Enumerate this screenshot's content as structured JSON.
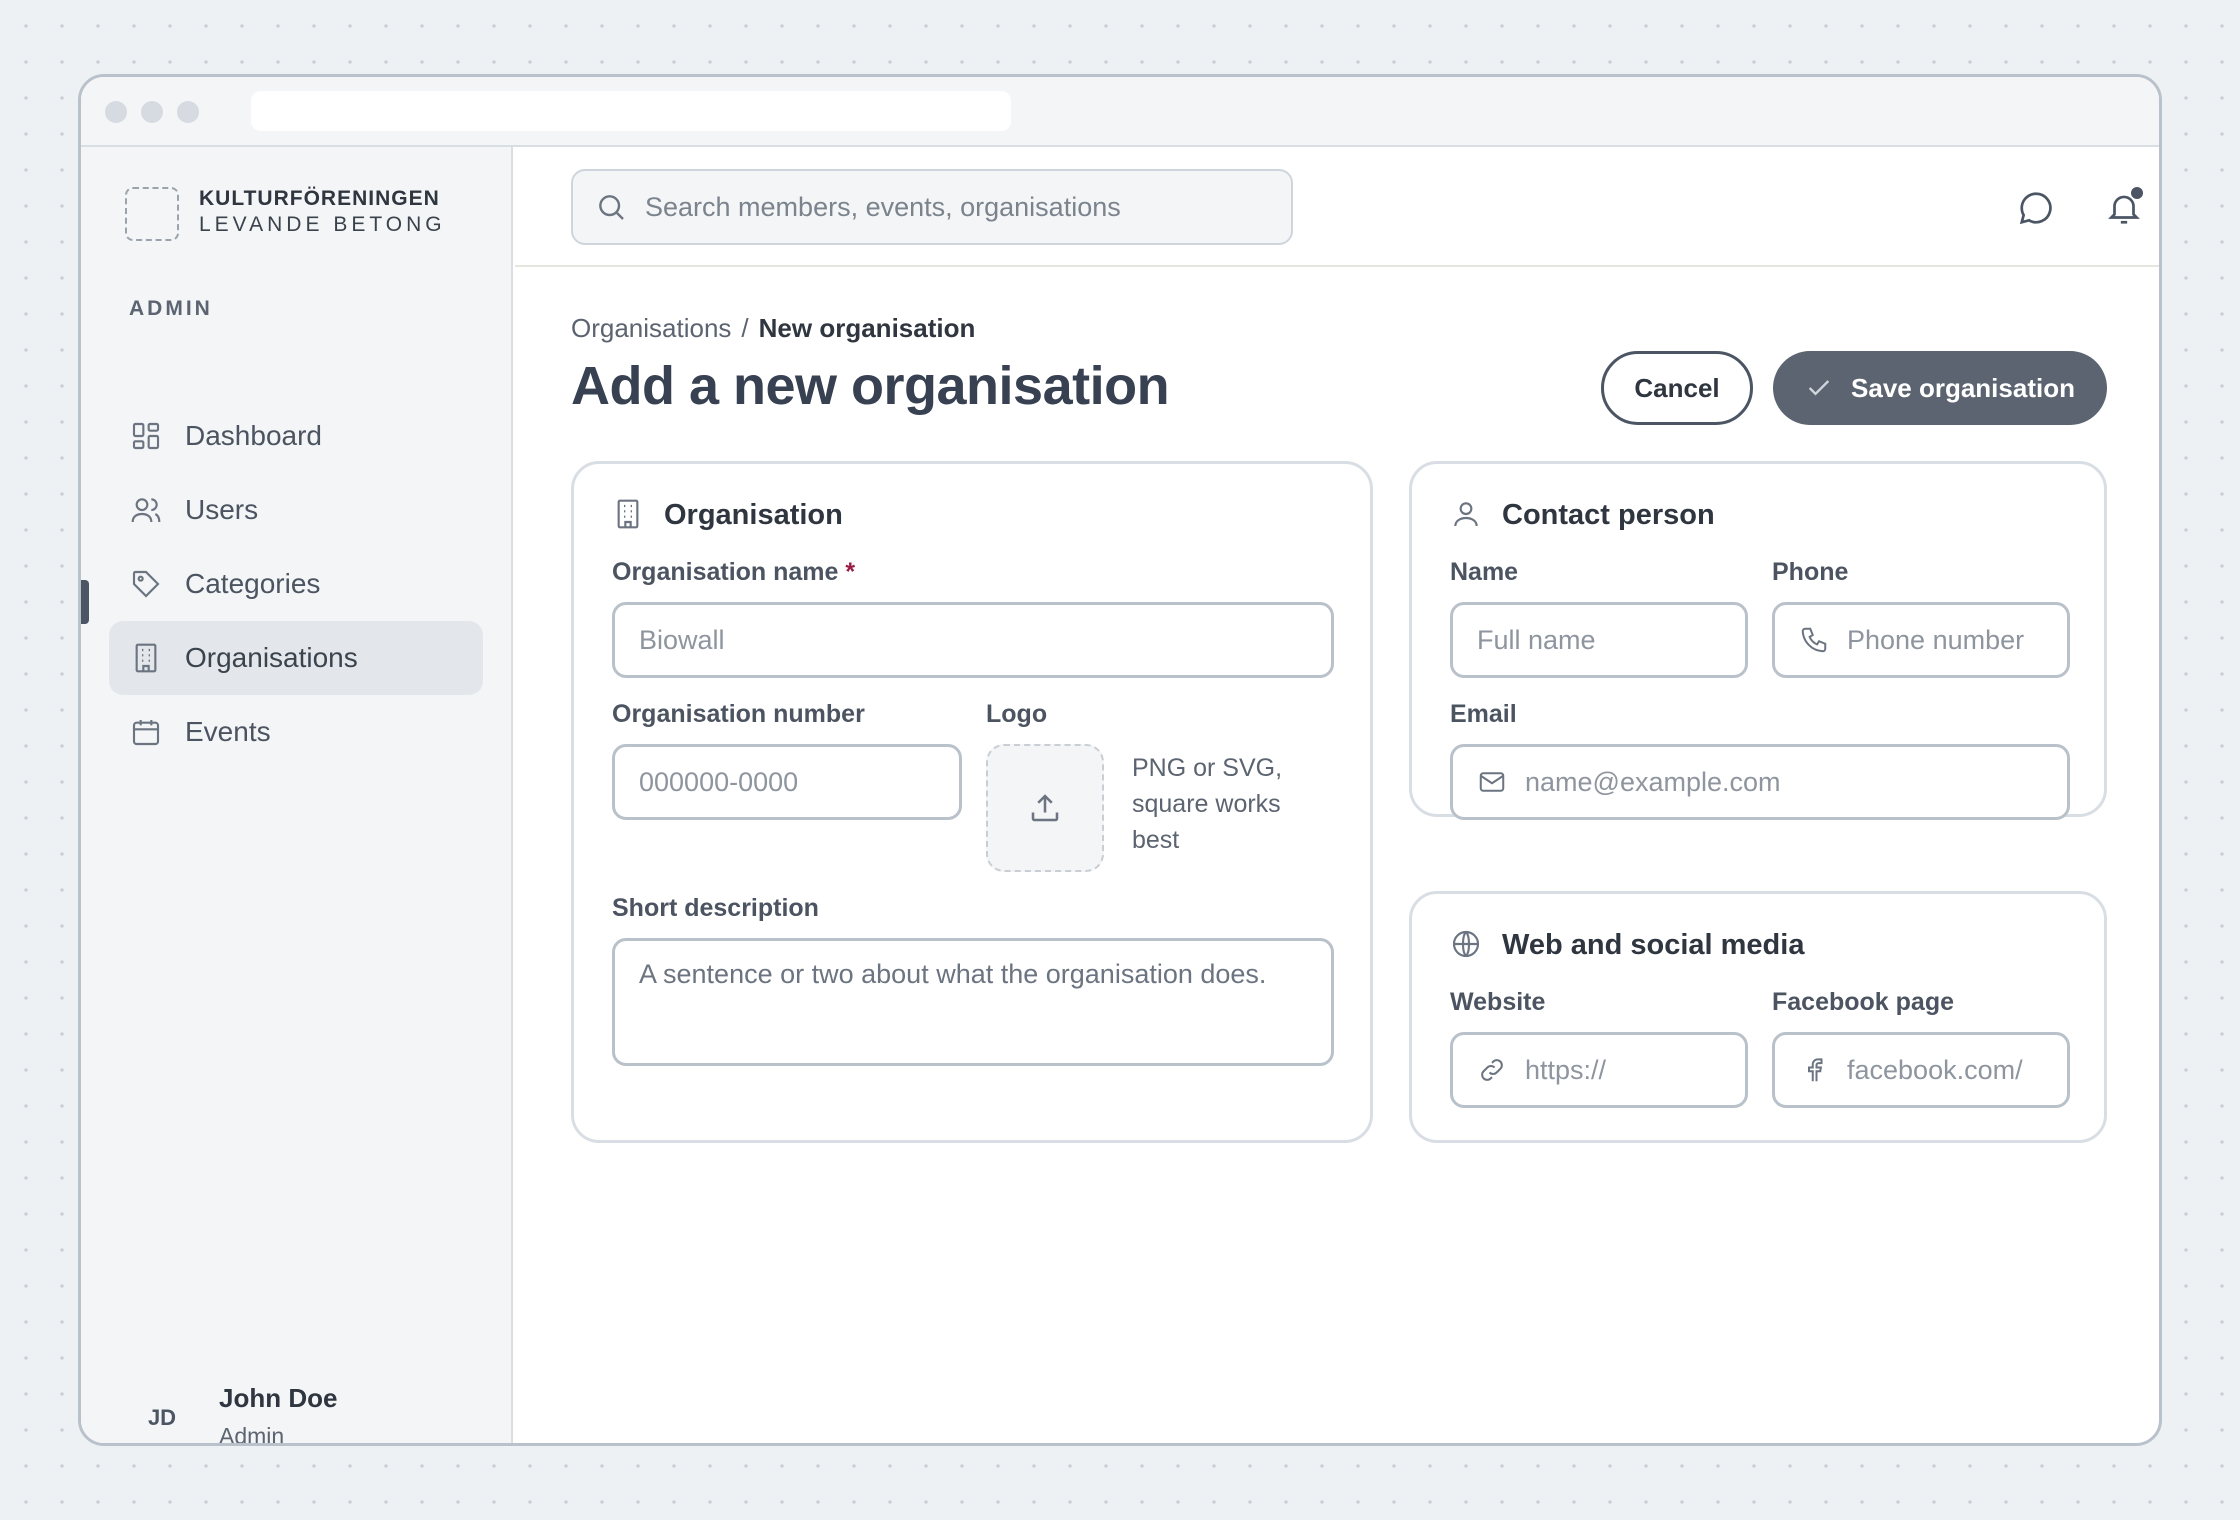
{
  "brand": {
    "line1": "KULTURFÖRENINGEN",
    "line2": "LEVANDE BETONG"
  },
  "sidebar": {
    "section": "ADMIN",
    "items": [
      {
        "label": "Dashboard",
        "icon": "dashboard-icon"
      },
      {
        "label": "Users",
        "icon": "users-icon"
      },
      {
        "label": "Categories",
        "icon": "tag-icon"
      },
      {
        "label": "Organisations",
        "icon": "building-icon",
        "active": true
      },
      {
        "label": "Events",
        "icon": "calendar-icon"
      }
    ],
    "user": {
      "initials": "JD",
      "name": "John Doe",
      "role": "Admin"
    }
  },
  "topbar": {
    "search_placeholder": "Search members, events, organisations"
  },
  "breadcrumb": {
    "parent": "Organisations",
    "separator": "/",
    "current": "New organisation"
  },
  "page": {
    "title": "Add a new organisation",
    "cancel_label": "Cancel",
    "save_label": "Save organisation"
  },
  "organisation": {
    "title": "Organisation",
    "name_label": "Organisation name",
    "required_mark": "*",
    "name_placeholder": "Biowall",
    "number_label": "Organisation number",
    "number_placeholder": "000000-0000",
    "logo_label": "Logo",
    "logo_hint": "PNG or SVG, square works best",
    "description_label": "Short description",
    "description_placeholder": "A sentence or two about what the organisation does."
  },
  "contact": {
    "title": "Contact person",
    "name_label": "Name",
    "name_placeholder": "Full name",
    "phone_label": "Phone",
    "phone_placeholder": "Phone number",
    "email_label": "Email",
    "email_placeholder": "name@example.com"
  },
  "web": {
    "title": "Web and social media",
    "website_label": "Website",
    "website_placeholder": "https://",
    "facebook_label": "Facebook page",
    "facebook_placeholder": "facebook.com/"
  },
  "colors": {
    "accent": "#5b6470",
    "required": "#9b1b45",
    "background": "#eef1f4"
  }
}
